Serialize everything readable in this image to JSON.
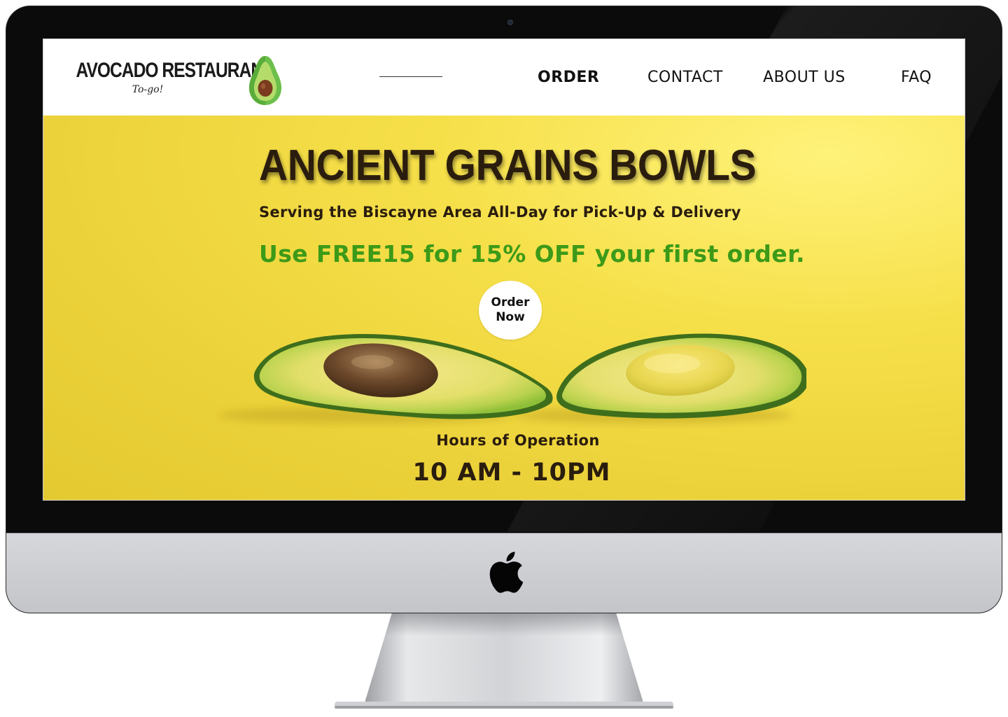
{
  "header": {
    "logo_title": "AVOCADO RESTAURANT",
    "logo_subtitle": "To-go!",
    "nav": [
      {
        "label": "ORDER"
      },
      {
        "label": "CONTACT"
      },
      {
        "label": "ABOUT US"
      },
      {
        "label": "FAQ"
      }
    ]
  },
  "hero": {
    "title": "ANCIENT GRAINS BOWLS",
    "subtitle": "Serving the Biscayne Area All-Day for Pick-Up & Delivery",
    "promo": "Use FREE15 for 15% OFF your first order.",
    "order_button": {
      "line1": "Order",
      "line2": "Now"
    },
    "hours_label": "Hours of Operation",
    "hours_value": "10 AM - 10PM"
  },
  "icons": {
    "logo": "avocado-icon",
    "device_brand": "apple-logo-icon",
    "camera": "camera-icon"
  },
  "colors": {
    "accent_green": "#3c9a18",
    "hero_yellow": "#f1da45",
    "text_dark": "#2a1d0e"
  }
}
